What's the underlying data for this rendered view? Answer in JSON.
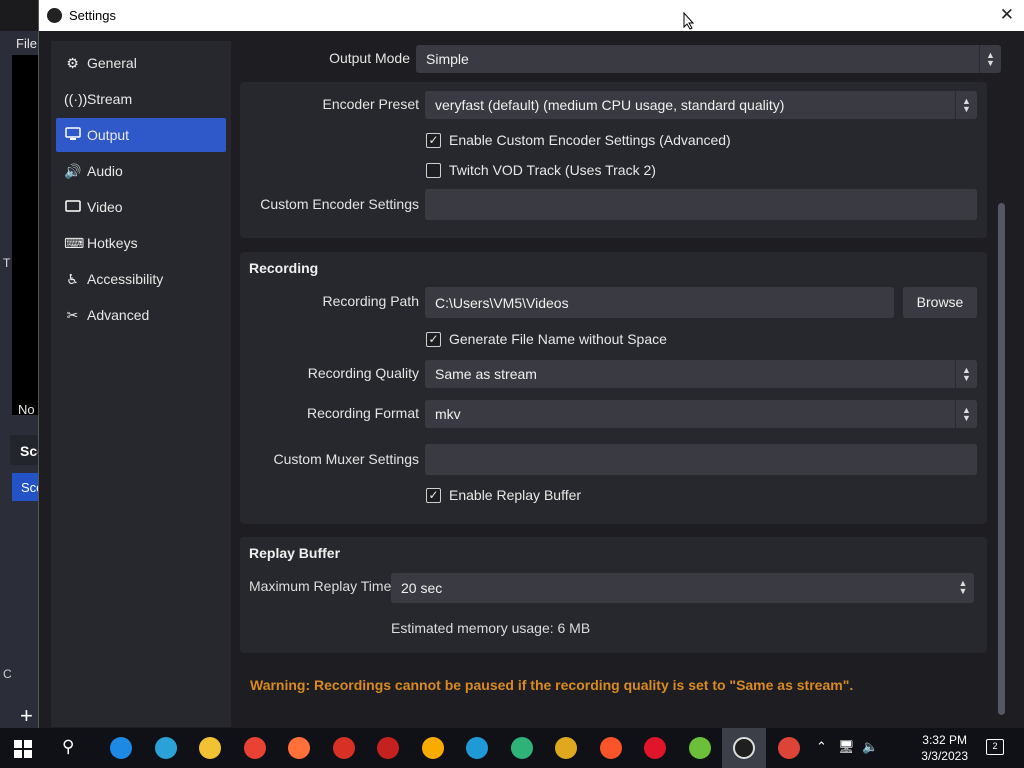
{
  "window": {
    "title": "Settings"
  },
  "background_app": {
    "file_menu": "File",
    "left_letter": "T",
    "no_label": "No",
    "scenes_header": "Sce",
    "scene_item": "Sce",
    "c_letter": "C",
    "add_button": "+"
  },
  "sidebar": {
    "items": [
      {
        "label": "General",
        "icon": "gear-icon"
      },
      {
        "label": "Stream",
        "icon": "antenna-icon"
      },
      {
        "label": "Output",
        "icon": "monitor-icon",
        "active": true
      },
      {
        "label": "Audio",
        "icon": "speaker-icon"
      },
      {
        "label": "Video",
        "icon": "screen-icon"
      },
      {
        "label": "Hotkeys",
        "icon": "keyboard-icon"
      },
      {
        "label": "Accessibility",
        "icon": "accessibility-icon"
      },
      {
        "label": "Advanced",
        "icon": "tools-icon"
      }
    ]
  },
  "output": {
    "mode_label": "Output Mode",
    "mode_value": "Simple",
    "encoder_preset_label": "Encoder Preset",
    "encoder_preset_value": "veryfast (default) (medium CPU usage, standard quality)",
    "enable_custom_encoder_label": "Enable Custom Encoder Settings (Advanced)",
    "enable_custom_encoder_checked": true,
    "twitch_vod_label": "Twitch VOD Track (Uses Track 2)",
    "twitch_vod_checked": false,
    "custom_encoder_settings_label": "Custom Encoder Settings",
    "custom_encoder_settings_value": ""
  },
  "recording": {
    "title": "Recording",
    "path_label": "Recording Path",
    "path_value": "C:\\Users\\VM5\\Videos",
    "browse_label": "Browse",
    "gen_filename_label": "Generate File Name without Space",
    "gen_filename_checked": true,
    "quality_label": "Recording Quality",
    "quality_value": "Same as stream",
    "format_label": "Recording Format",
    "format_value": "mkv",
    "muxer_label": "Custom Muxer Settings",
    "muxer_value": "",
    "replay_buffer_label": "Enable Replay Buffer",
    "replay_buffer_checked": true
  },
  "replay_buffer": {
    "title": "Replay Buffer",
    "max_time_label": "Maximum Replay Time",
    "max_time_value": "20 sec",
    "memory_usage": "Estimated memory usage: 6 MB"
  },
  "warning": "Warning: Recordings cannot be paused if the recording quality is set to \"Same as stream\".",
  "taskbar": {
    "time": "3:32 PM",
    "date": "3/3/2023",
    "notification_count": "2",
    "apps": [
      {
        "name": "ie-icon",
        "color": "#1e88e5"
      },
      {
        "name": "edge-icon",
        "color": "#2aa2d8"
      },
      {
        "name": "file-explorer-icon",
        "color": "#f1c232"
      },
      {
        "name": "chrome-icon",
        "color": "#e94235"
      },
      {
        "name": "firefox-icon",
        "color": "#ff7139"
      },
      {
        "name": "chrome-beta-icon",
        "color": "#d93025"
      },
      {
        "name": "chrome-dev-icon",
        "color": "#c5221f"
      },
      {
        "name": "chrome-canary-icon",
        "color": "#f9ab00"
      },
      {
        "name": "edge-beta-icon",
        "color": "#1f9ad6"
      },
      {
        "name": "edge-dev-icon",
        "color": "#2fb277"
      },
      {
        "name": "edge-canary-icon",
        "color": "#e0a81d"
      },
      {
        "name": "brave-icon",
        "color": "#fb542b"
      },
      {
        "name": "opera-icon",
        "color": "#e0142b"
      },
      {
        "name": "pin-app-icon",
        "color": "#6bbf3a"
      },
      {
        "name": "obs-icon",
        "color": "#1f1f1f"
      },
      {
        "name": "chrome-shield-icon",
        "color": "#db4437"
      }
    ]
  }
}
